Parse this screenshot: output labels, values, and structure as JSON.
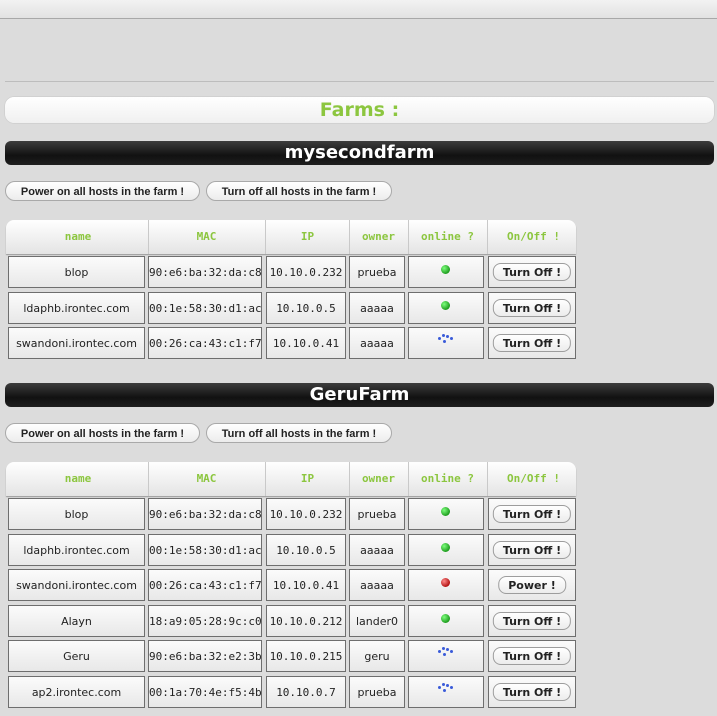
{
  "page": {
    "heading": "Farms :"
  },
  "columns": [
    "name",
    "MAC",
    "IP",
    "owner",
    "online ?",
    "On/Off !"
  ],
  "farms": [
    {
      "name": "mysecondfarm",
      "power_on_all_label": "Power on all hosts in the farm !",
      "turn_off_all_label": "Turn off all hosts in the farm !",
      "hosts": [
        {
          "name": "blop",
          "mac": "90:e6:ba:32:da:c8",
          "ip": "10.10.0.232",
          "owner": "prueba",
          "status": "online",
          "action": "Turn Off !"
        },
        {
          "name": "ldaphb.irontec.com",
          "mac": "00:1e:58:30:d1:ac",
          "ip": "10.10.0.5",
          "owner": "aaaaa",
          "status": "online",
          "action": "Turn Off !"
        },
        {
          "name": "swandoni.irontec.com",
          "mac": "00:26:ca:43:c1:f7",
          "ip": "10.10.0.41",
          "owner": "aaaaa",
          "status": "loading",
          "action": "Turn Off !"
        }
      ]
    },
    {
      "name": "GeruFarm",
      "power_on_all_label": "Power on all hosts in the farm !",
      "turn_off_all_label": "Turn off all hosts in the farm !",
      "hosts": [
        {
          "name": "blop",
          "mac": "90:e6:ba:32:da:c8",
          "ip": "10.10.0.232",
          "owner": "prueba",
          "status": "online",
          "action": "Turn Off !"
        },
        {
          "name": "ldaphb.irontec.com",
          "mac": "00:1e:58:30:d1:ac",
          "ip": "10.10.0.5",
          "owner": "aaaaa",
          "status": "online",
          "action": "Turn Off !"
        },
        {
          "name": "swandoni.irontec.com",
          "mac": "00:26:ca:43:c1:f7",
          "ip": "10.10.0.41",
          "owner": "aaaaa",
          "status": "offline",
          "action": "Power !"
        },
        {
          "name": "Alayn",
          "mac": "18:a9:05:28:9c:c0",
          "ip": "10.10.0.212",
          "owner": "lander0",
          "status": "online",
          "action": "Turn Off !"
        },
        {
          "name": "Geru",
          "mac": "90:e6:ba:32:e2:3b",
          "ip": "10.10.0.215",
          "owner": "geru",
          "status": "loading",
          "action": "Turn Off !"
        },
        {
          "name": "ap2.irontec.com",
          "mac": "00:1a:70:4e:f5:4b",
          "ip": "10.10.0.7",
          "owner": "prueba",
          "status": "loading",
          "action": "Turn Off !"
        }
      ]
    }
  ],
  "colors": {
    "accent": "#8cc63f",
    "online": "#1e9c1e",
    "offline": "#b21212",
    "loading": "#3a5bd9"
  }
}
